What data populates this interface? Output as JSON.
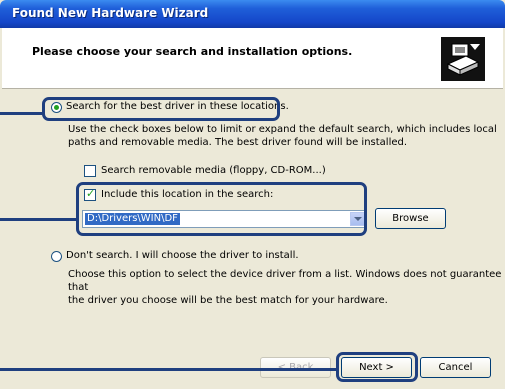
{
  "window": {
    "title": "Found New Hardware Wizard"
  },
  "header": {
    "heading": "Please choose your search and installation options."
  },
  "options": {
    "search_best": {
      "label": "Search for the best driver in these locations."
    },
    "search_description_line1": "Use the check boxes below to limit or expand the default search, which includes local",
    "search_description_line2": "paths and removable media. The best driver found will be installed.",
    "removable_media": {
      "label": "Search removable media (floppy, CD-ROM...)"
    },
    "include_location": {
      "label": "Include this location in the search:"
    },
    "location_path": "D:\\Drivers\\WIN\\DF",
    "browse_label": "Browse",
    "dont_search": {
      "label": "Don't search. I will choose the driver to install."
    },
    "dont_search_description_line1": "Choose this option to select the device driver from a list.  Windows does not guarantee that",
    "dont_search_description_line2": "the driver you choose will be the best match for your hardware."
  },
  "buttons": {
    "back": "< Back",
    "next": "Next >",
    "cancel": "Cancel"
  },
  "icons": [
    "hardware-wizard-icon"
  ],
  "colors": {
    "titlebar": "#1446c9",
    "highlight": "#1f3f7f",
    "window": "#ece9d8"
  }
}
